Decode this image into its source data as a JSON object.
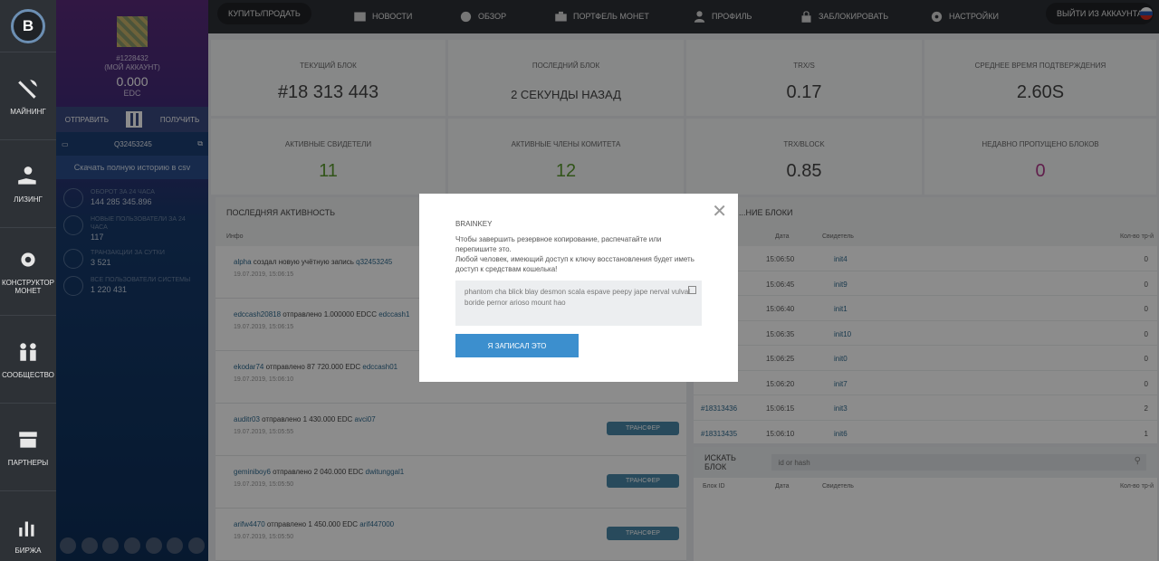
{
  "topbar": {
    "buy_sell": "КУПИТЬ/ПРОДАТЬ",
    "nav": [
      "НОВОСТИ",
      "ОБЗОР",
      "ПОРТФЕЛЬ МОНЕТ",
      "ПРОФИЛЬ",
      "ЗАБЛОКИРОВАТЬ",
      "НАСТРОЙКИ"
    ],
    "logout": "ВЫЙТИ ИЗ АККАУНТА"
  },
  "rail": {
    "items": [
      "МАЙНИНГ",
      "ЛИЗИНГ",
      "КОНСТРУКТОР МОНЕТ",
      "СООБЩЕСТВО",
      "ПАРТНЕРЫ",
      "БИРЖА"
    ]
  },
  "account": {
    "id": "#1228432",
    "my_account": "(МОЙ АККАУНТ)",
    "balance": "0.000",
    "currency": "EDC",
    "send": "ОТПРАВИТЬ",
    "receive": "ПОЛУЧИТЬ",
    "address": "Q32453245",
    "csv": "Скачать полную историю в csv",
    "stats": [
      {
        "title": "ОБОРОТ ЗА 24 ЧАСА",
        "value": "144 285 345.896"
      },
      {
        "title": "НОВЫЕ ПОЛЬЗОВАТЕЛИ ЗА 24 ЧАСА",
        "value": "117"
      },
      {
        "title": "ТРАНЗАКЦИИ ЗА СУТКИ",
        "value": "3 521"
      },
      {
        "title": "ВСЕ ПОЛЬЗОВАТЕЛИ СИСТЕМЫ",
        "value": "1 220 431"
      }
    ]
  },
  "cards": [
    {
      "title": "ТЕКУЩИЙ БЛОК",
      "value": "#18 313 443",
      "color": "#444444"
    },
    {
      "title": "ПОСЛЕДНИЙ БЛОК",
      "value": "2 СЕКУНДЫ НАЗАД",
      "color": "#444444"
    },
    {
      "title": "TRX/S",
      "value": "0.17",
      "color": "#444444"
    },
    {
      "title": "СРЕДНЕЕ ВРЕМЯ ПОДТВЕРЖДЕНИЯ",
      "value": "2.60S",
      "color": "#444444"
    },
    {
      "title": "АКТИВНЫЕ СВИДЕТЕЛИ",
      "value": "11",
      "color": "#5a9a2e"
    },
    {
      "title": "АКТИВНЫЕ ЧЛЕНЫ КОМИТЕТА",
      "value": "12",
      "color": "#5a9a2e"
    },
    {
      "title": "TRX/BLOCK",
      "value": "0.85",
      "color": "#444444"
    },
    {
      "title": "НЕДАВНО ПРОПУЩЕНО БЛОКОВ",
      "value": "0",
      "color": "#b03a8a"
    }
  ],
  "activity": {
    "title": "ПОСЛЕДНЯЯ АКТИВНОСТЬ",
    "col_info": "Инфо",
    "rows": [
      {
        "user": "alpha",
        "text": " создал новую учётную запись ",
        "target": "q32453245",
        "date": "19.07.2019, 15:06:15",
        "tag": ""
      },
      {
        "user": "edccash20818",
        "text": " отправлено 1.000000 EDCC ",
        "target": "edccash1",
        "date": "19.07.2019, 15:06:15",
        "tag": ""
      },
      {
        "user": "ekodar74",
        "text": " отправлено 87 720.000 EDC ",
        "target": "edccash01",
        "date": "19.07.2019, 15:06:10",
        "tag": ""
      },
      {
        "user": "auditr03",
        "text": " отправлено 1 430.000 EDC ",
        "target": "avci07",
        "date": "19.07.2019, 15:05:55",
        "tag": "ТРАНСФЕР"
      },
      {
        "user": "geminiboy6",
        "text": " отправлено 2 040.000 EDC ",
        "target": "dwitunggal1",
        "date": "19.07.2019, 15:05:50",
        "tag": "ТРАНСФЕР"
      },
      {
        "user": "arifw4470",
        "text": " отправлено 1 450.000 EDC ",
        "target": "arif447000",
        "date": "19.07.2019, 15:05:50",
        "tag": "ТРАНСФЕР"
      }
    ]
  },
  "blocks": {
    "title": "...НИЕ БЛОКИ",
    "cols": [
      "Дата",
      "Свидетель",
      "Кол-во тр-й"
    ],
    "rows": [
      {
        "id": "",
        "time": "15:06:50",
        "witness": "init4",
        "trx": "0"
      },
      {
        "id": "",
        "time": "15:06:45",
        "witness": "init9",
        "trx": "0"
      },
      {
        "id": "",
        "time": "15:06:40",
        "witness": "init1",
        "trx": "0"
      },
      {
        "id": "",
        "time": "15:06:35",
        "witness": "init10",
        "trx": "0"
      },
      {
        "id": "",
        "time": "15:06:25",
        "witness": "init0",
        "trx": "0"
      },
      {
        "id": "",
        "time": "15:06:20",
        "witness": "init7",
        "trx": "0"
      },
      {
        "id": "#18313436",
        "time": "15:06:15",
        "witness": "init3",
        "trx": "2"
      },
      {
        "id": "#18313435",
        "time": "15:06:10",
        "witness": "init6",
        "trx": "1"
      }
    ]
  },
  "search": {
    "title": "ИСКАТЬ БЛОК",
    "placeholder": "id or hash",
    "cols": [
      "Блок ID",
      "Дата",
      "Свидетель",
      "Кол-во тр-й"
    ]
  },
  "modal": {
    "title": "BRAINKEY",
    "text": "Чтобы завершить резервное копирование, распечатайте или перепишите это.\nЛюбой человек, имеющий доступ к ключу восстановления будет иметь доступ к средствам кошелька!",
    "key": "phantom cha blick blay desmon scala espave peepy jape nerval vulval boride pernor arioso mount hao",
    "button": "Я ЗАПИСАЛ ЭТО"
  },
  "colors": {
    "accent": "#3c8fce",
    "tag": "#4a88a8",
    "link": "#2f6a8f"
  }
}
